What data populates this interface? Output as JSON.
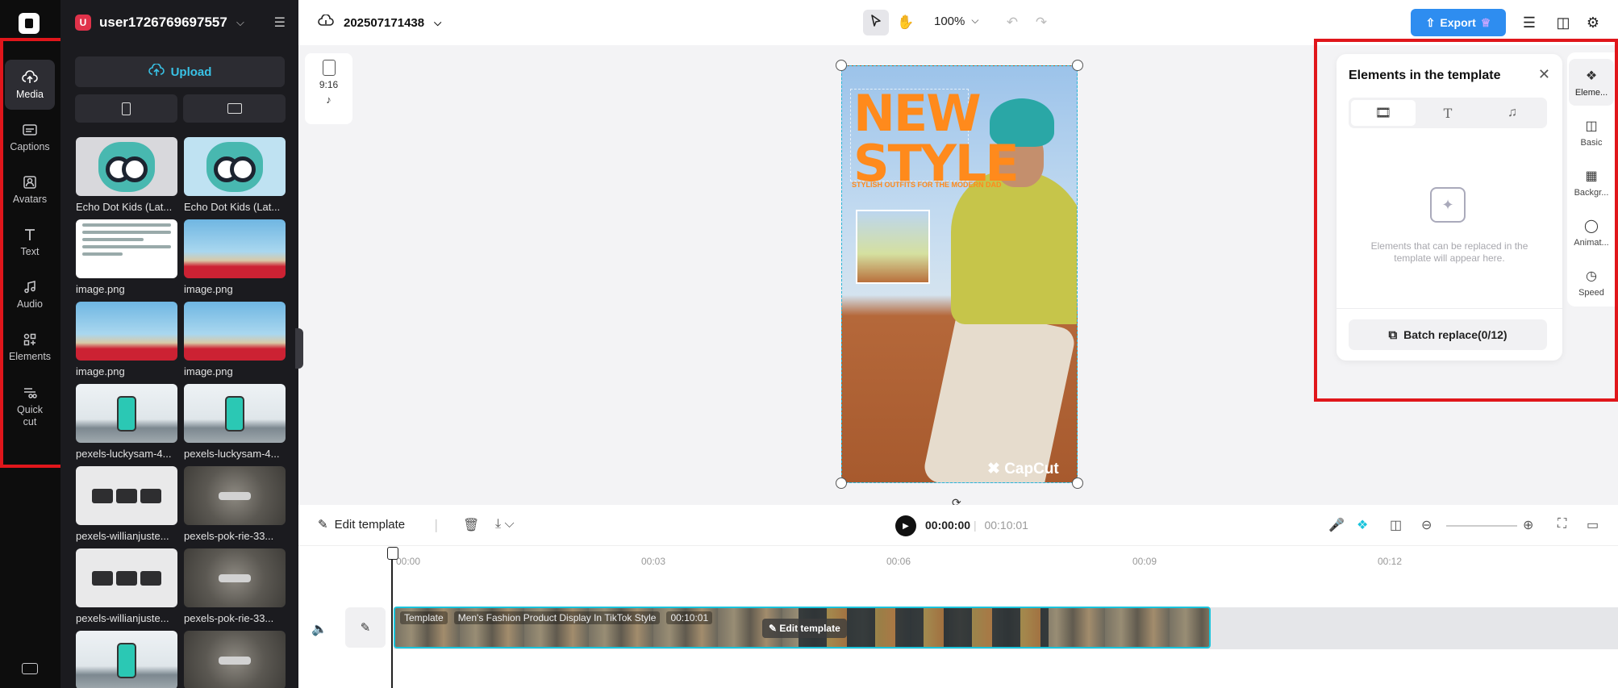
{
  "rail": {
    "items": [
      {
        "label": "Media",
        "icon": "cloud-upload-icon"
      },
      {
        "label": "Captions",
        "icon": "captions-icon"
      },
      {
        "label": "Avatars",
        "icon": "avatar-icon"
      },
      {
        "label": "Text",
        "icon": "text-icon"
      },
      {
        "label": "Audio",
        "icon": "music-note-icon"
      },
      {
        "label": "Elements",
        "icon": "elements-icon"
      },
      {
        "label": "Quick cut",
        "icon": "quick-cut-icon"
      }
    ]
  },
  "panel": {
    "avatar_letter": "U",
    "username": "user1726769697557",
    "upload_label": "Upload",
    "media": [
      {
        "label": "Echo Dot Kids (Lat...",
        "kind": "owl"
      },
      {
        "label": "Echo Dot Kids (Lat...",
        "kind": "owl2"
      },
      {
        "label": "image.png",
        "kind": "tweet"
      },
      {
        "label": "image.png",
        "kind": "oldspice"
      },
      {
        "label": "image.png",
        "kind": "oldspice"
      },
      {
        "label": "image.png",
        "kind": "oldspice"
      },
      {
        "label": "pexels-luckysam-4...",
        "kind": "phone"
      },
      {
        "label": "pexels-luckysam-4...",
        "kind": "phone"
      },
      {
        "label": "pexels-willianjuste...",
        "kind": "gear"
      },
      {
        "label": "pexels-pok-rie-33...",
        "kind": "drone"
      },
      {
        "label": "pexels-willianjuste...",
        "kind": "gear"
      },
      {
        "label": "pexels-pok-rie-33...",
        "kind": "drone"
      },
      {
        "label": "",
        "kind": "phone"
      },
      {
        "label": "",
        "kind": "drone"
      }
    ]
  },
  "topbar": {
    "project_name": "202507171438",
    "zoom": "100%",
    "export_label": "Export"
  },
  "canvas": {
    "ratio": "9:16",
    "preview": {
      "headline": "NEW STYLE",
      "subline": "STYLISH OUTFITS FOR THE MODERN DAD",
      "watermark": "CapCut"
    }
  },
  "elements_panel": {
    "title": "Elements in the template",
    "empty_text": "Elements that can be replaced in the template will appear here.",
    "batch_label": "Batch replace(0/12)"
  },
  "side_tabs": [
    {
      "label": "Eleme...",
      "icon": "elements-icon"
    },
    {
      "label": "Basic",
      "icon": "basic-icon"
    },
    {
      "label": "Backgr...",
      "icon": "background-icon"
    },
    {
      "label": "Animat...",
      "icon": "animation-icon"
    },
    {
      "label": "Speed",
      "icon": "speed-icon"
    }
  ],
  "timeline": {
    "edit_template_label": "Edit template",
    "current_time": "00:00:00",
    "total_time": "00:10:01",
    "ticks": [
      "00:00",
      "00:03",
      "00:06",
      "00:09",
      "00:12"
    ],
    "clip": {
      "tag": "Template",
      "name": "Men's Fashion Product Display In TikTok Style",
      "duration": "00:10:01",
      "edit_label": "Edit template"
    }
  },
  "colors": {
    "accent": "#2e8df0",
    "highlight": "#e0161b",
    "selection": "#19c4dc",
    "headline": "#ff8a1c"
  }
}
